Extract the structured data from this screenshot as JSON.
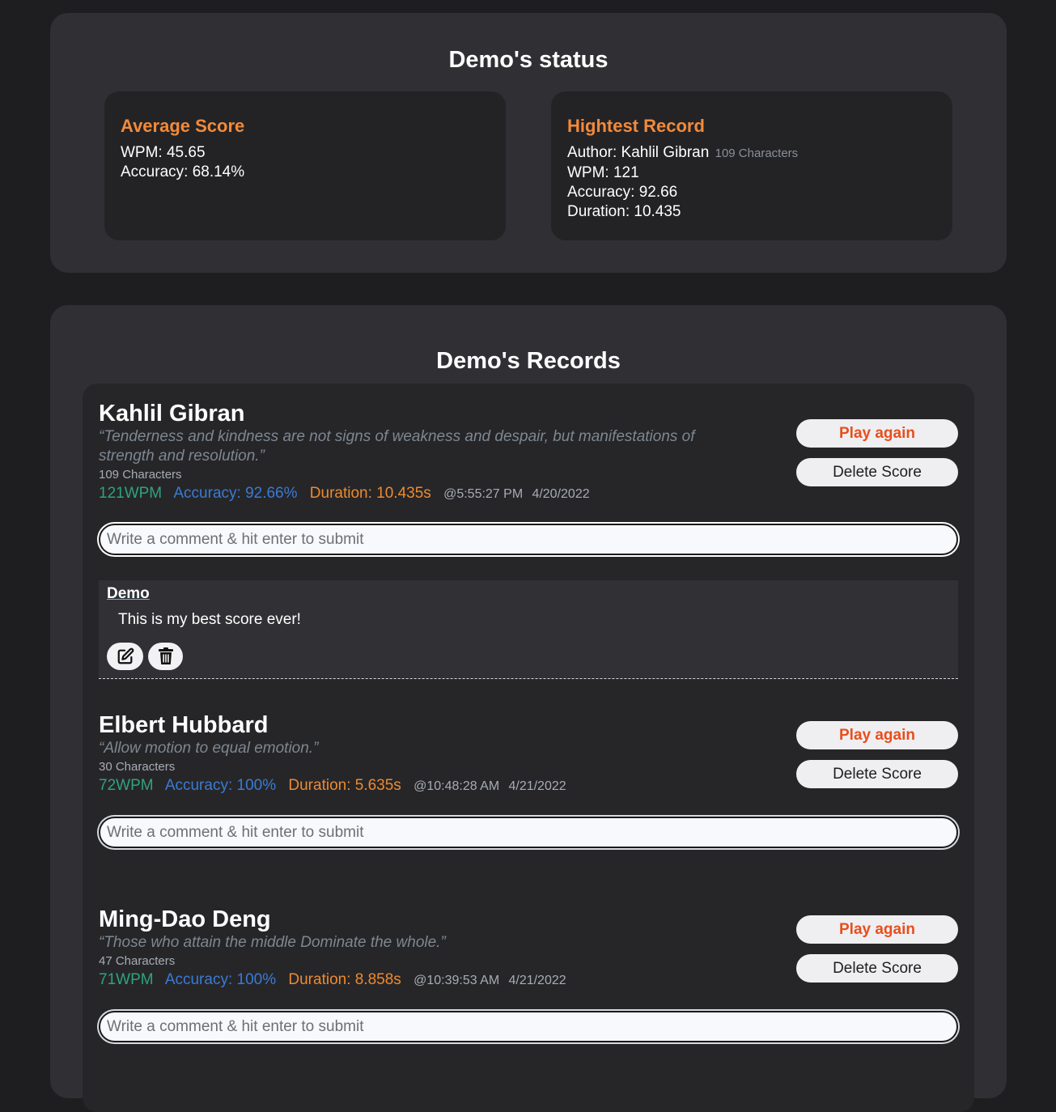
{
  "status": {
    "title": "Demo's status",
    "average": {
      "title": "Average Score",
      "wpm": "WPM: 45.65",
      "accuracy": "Accuracy: 68.14%"
    },
    "highest": {
      "title": "Hightest Record",
      "author": "Author: Kahlil Gibran",
      "characters": "109 Characters",
      "wpm": "WPM: 121",
      "accuracy": "Accuracy: 92.66",
      "duration": "Duration: 10.435"
    }
  },
  "records": {
    "title": "Demo's Records",
    "comment_placeholder": "Write a comment & hit enter to submit",
    "play_again_label": "Play again",
    "delete_label": "Delete Score",
    "items": [
      {
        "author": "Kahlil Gibran",
        "quote": "“Tenderness and kindness are not signs of weakness and despair, but manifestations of strength and resolution.”",
        "characters": "109 Characters",
        "wpm": "121WPM",
        "accuracy": "Accuracy: 92.66%",
        "duration": "Duration: 10.435s",
        "time": "@5:55:27 PM",
        "date": "4/20/2022",
        "comment": {
          "user": "Demo",
          "text": "This is my best score ever!",
          "edit_icon": "edit-icon",
          "delete_icon": "trash-icon"
        }
      },
      {
        "author": "Elbert Hubbard",
        "quote": "“Allow motion to equal emotion.”",
        "characters": "30 Characters",
        "wpm": "72WPM",
        "accuracy": "Accuracy: 100%",
        "duration": "Duration: 5.635s",
        "time": "@10:48:28 AM",
        "date": "4/21/2022"
      },
      {
        "author": "Ming-Dao Deng",
        "quote": "“Those who attain the middle Dominate the whole.”",
        "characters": "47 Characters",
        "wpm": "71WPM",
        "accuracy": "Accuracy: 100%",
        "duration": "Duration: 8.858s",
        "time": "@10:39:53 AM",
        "date": "4/21/2022"
      }
    ]
  },
  "colors": {
    "accent_orange": "#f28a3a",
    "play_red": "#e94e1b",
    "wpm_green": "#2fa37c",
    "accuracy_blue": "#3a7bd5",
    "duration_orange": "#ee8a2e"
  }
}
